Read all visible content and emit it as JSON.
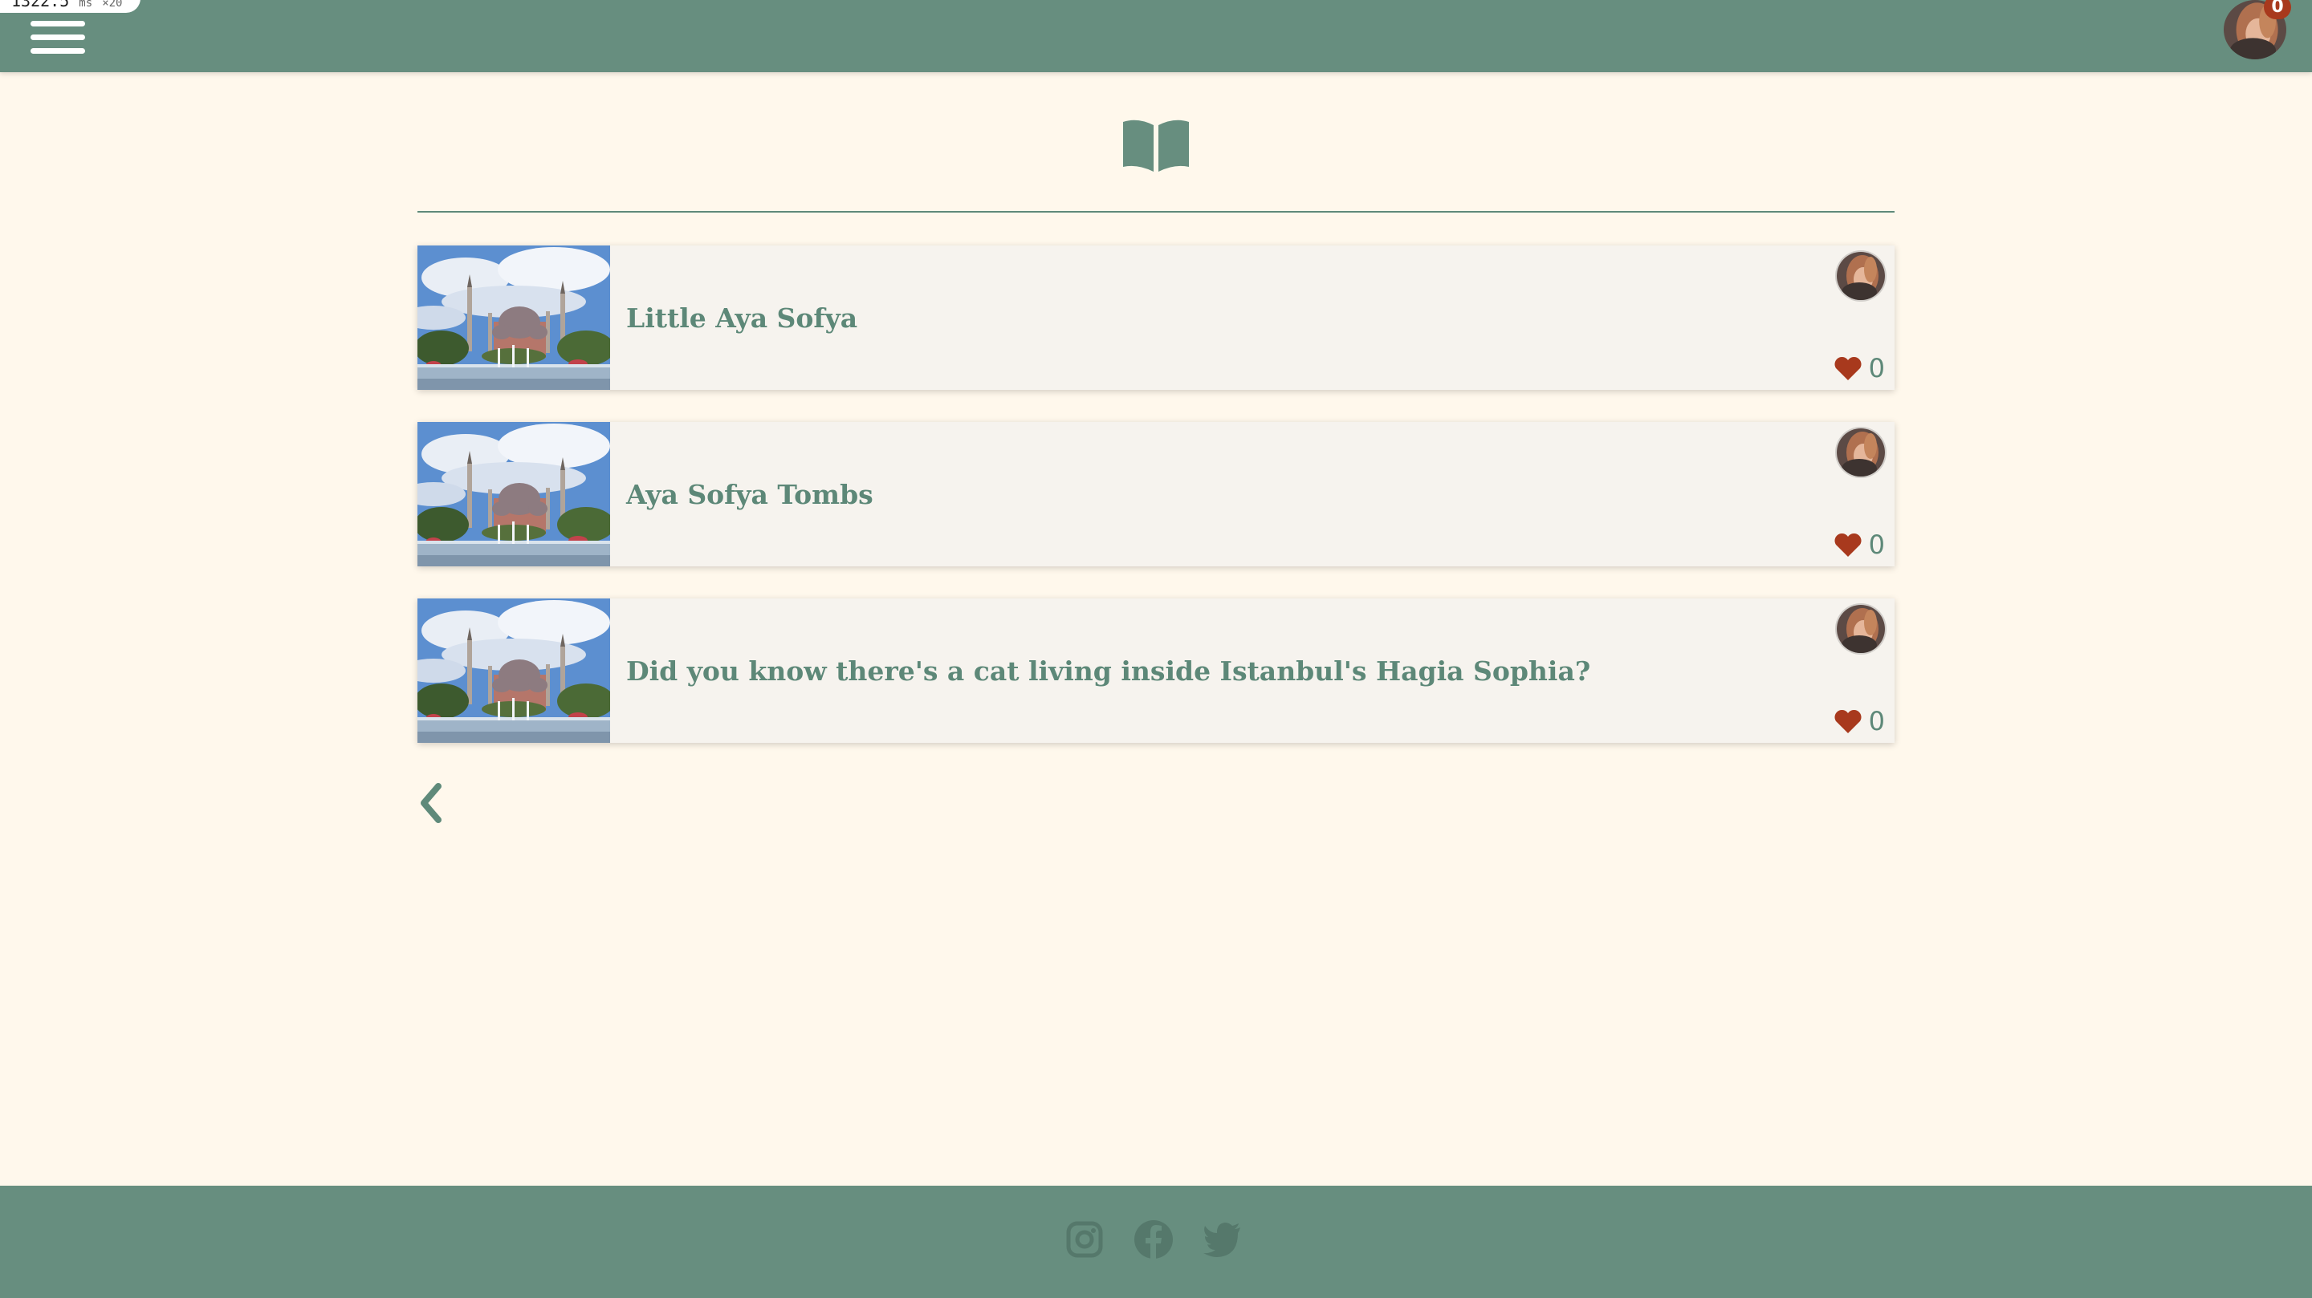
{
  "perf": {
    "value": "1322.5",
    "unit": "ms",
    "multiplier": "×20"
  },
  "header": {
    "menu_icon": "hamburger-menu-icon",
    "notification_count": "0",
    "avatar": "user-avatar"
  },
  "main": {
    "section_icon": "open-book-icon",
    "posts": [
      {
        "title": "Little Aya Sofya",
        "likes": "0",
        "thumbnail": "hagia-sophia-photo",
        "author": "author-avatar"
      },
      {
        "title": "Aya Sofya Tombs",
        "likes": "0",
        "thumbnail": "hagia-sophia-photo",
        "author": "author-avatar"
      },
      {
        "title": "Did you know there's a cat living inside Istanbul's Hagia Sophia?",
        "likes": "0",
        "thumbnail": "hagia-sophia-photo",
        "author": "author-avatar"
      }
    ],
    "pagination": {
      "prev_icon": "chevron-left-icon"
    }
  },
  "footer": {
    "social": [
      "instagram-icon",
      "facebook-icon",
      "twitter-icon"
    ]
  },
  "colors": {
    "primary": "#678e7f",
    "background": "#fff8ec",
    "card": "#f6f3ee",
    "text": "#5d8878",
    "heart": "#a8391d",
    "footer_icon": "#55786b"
  }
}
